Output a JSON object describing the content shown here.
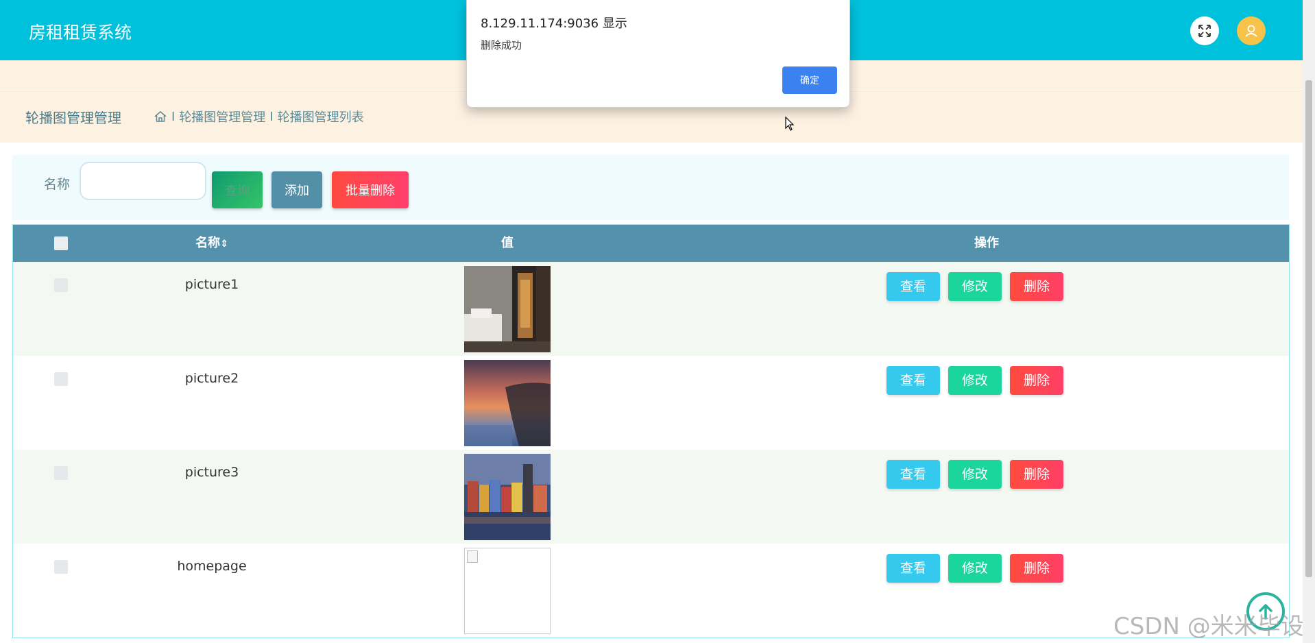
{
  "header": {
    "app_title": "房租租赁系统"
  },
  "breadcrumb_bar": {
    "page_title": "轮播图管理管理",
    "crumbs": [
      "轮播图管理管理",
      "轮播图管理列表"
    ],
    "separator": "I"
  },
  "search": {
    "name_label": "名称",
    "name_value": "",
    "name_placeholder": "",
    "query_label": "查询",
    "add_label": "添加",
    "batch_delete_label": "批量删除"
  },
  "table": {
    "columns": [
      "名称",
      "值",
      "操作"
    ],
    "sort_indicator": "⇕",
    "rows": [
      {
        "name": "picture1",
        "image": "bedroom-photo"
      },
      {
        "name": "picture2",
        "image": "sunset-photo"
      },
      {
        "name": "picture3",
        "image": "city-photo"
      },
      {
        "name": "homepage",
        "image": "broken-image"
      }
    ],
    "actions": {
      "view": "查看",
      "edit": "修改",
      "delete": "删除"
    }
  },
  "dialog": {
    "host": "8.129.11.174:9036 显示",
    "message": "删除成功",
    "ok_label": "确定"
  },
  "watermark": "CSDN @米米毕设",
  "colors": {
    "header": "#00c1dc",
    "table_header": "#5391ad",
    "view": "#35c9ee",
    "edit": "#1bd69c",
    "delete": "#ff4b3e",
    "dialog_ok": "#3b82f0"
  }
}
